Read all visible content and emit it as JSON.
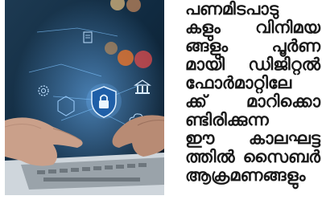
{
  "article": {
    "lines": [
      "പണമിടപാടു",
      "കളും വിനിമയ",
      "ങ്ങളും പൂർണ",
      "മായി ഡിജിറ്റൽ",
      "ഫോർമാറ്റിലേ",
      "ക്ക് മാറിക്കൊ",
      "ണ്ടിരിക്കുന്ന",
      "ഈ കാലഘട്ട",
      "ത്തിൽ സൈബർ",
      "ആക്രമണങ്ങളും"
    ]
  },
  "photo": {
    "description_icon": "cyber-security-hands-laptop",
    "center_icon": "shield-lock-icon",
    "floating_icons": [
      "bank-icon",
      "document-icon",
      "gear-icon",
      "cloud-icon",
      "hexagon-icon"
    ],
    "colors": {
      "background_dark": "#0f2233",
      "glow_blue": "#4aa3ff",
      "bokeh_orange": "#e8742c",
      "bokeh_red": "#e04a4a",
      "skin": "#caa08a"
    }
  }
}
